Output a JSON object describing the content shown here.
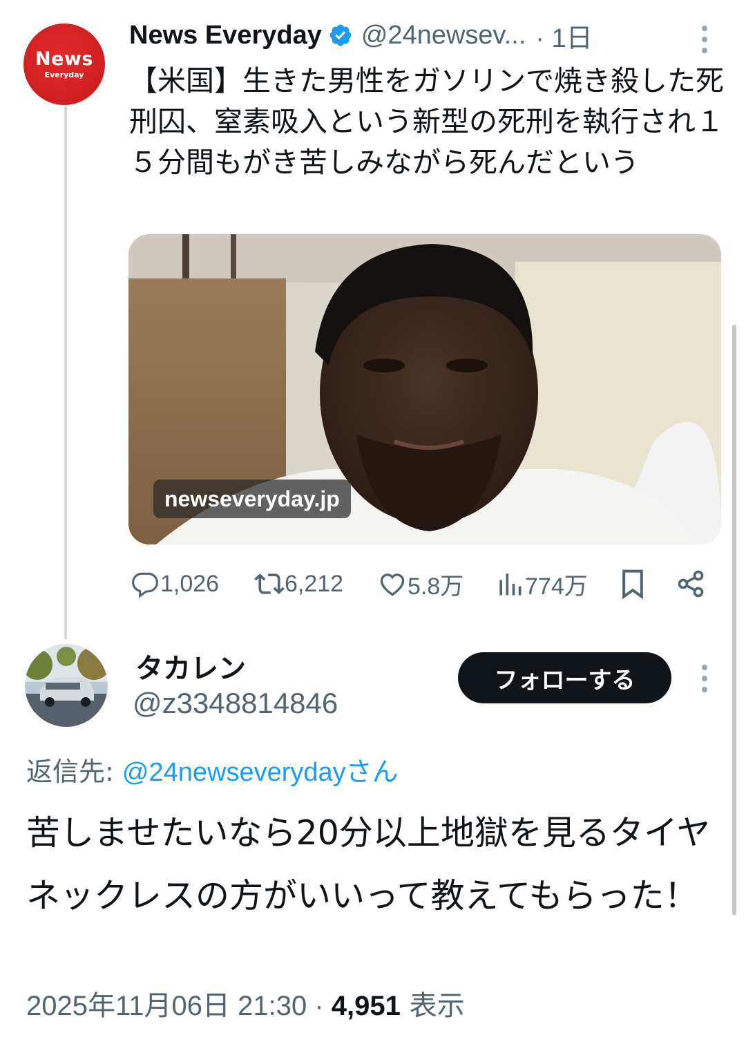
{
  "tweet1": {
    "avatar": {
      "line1": "News",
      "line2": "Everyday",
      "color": "#d32222"
    },
    "display_name": "News Everyday",
    "verified_icon": "verified-badge-icon",
    "handle": "@24newsev...",
    "time": "· 1日",
    "text": "【米国】生きた男性をガソリンで焼き殺した死刑囚、窒素吸入という新型の死刑を執行され１５分間もがき苦しみながら死んだという",
    "card": {
      "domain": "newseveryday.jp",
      "image": "photo-of-man-in-white-shirt"
    },
    "actions": {
      "replies": "1,026",
      "retweets": "6,212",
      "likes": "5.8万",
      "views": "774万"
    }
  },
  "tweet2": {
    "display_name": "タカレン",
    "handle": "@z3348814846",
    "follow_label": "フォローする",
    "reply_prefix": "返信先: ",
    "reply_mention": "@24newseveryday",
    "reply_suffix": "さん",
    "text": "苦しませたいなら20分以上地獄を見るタイヤネックレスの方がいいって教えてもらった！",
    "date": "2025年11月06日 21:30 · ",
    "views_count": "4,951",
    "views_label": " 表示"
  },
  "colors": {
    "text": "#0f1419",
    "secondary": "#536471",
    "link": "#1d9bf0",
    "verified": "#1d9bf0"
  }
}
